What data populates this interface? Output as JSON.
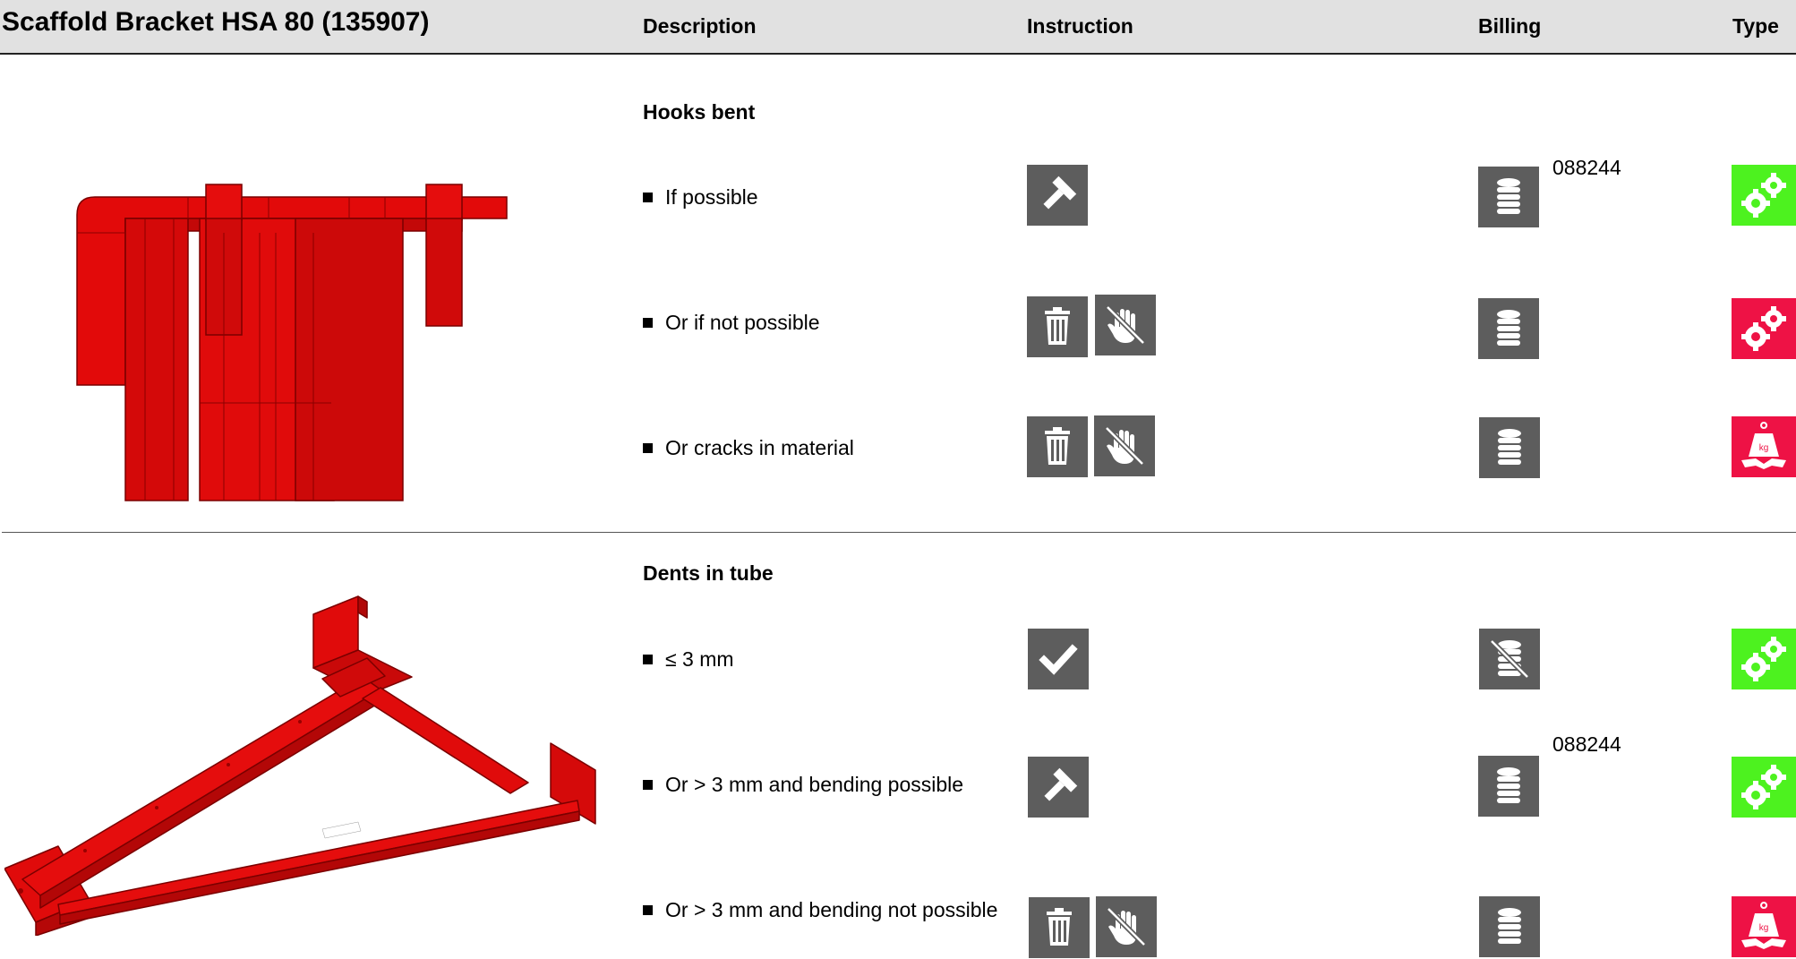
{
  "header": {
    "title": "Scaffold Bracket HSA 80 (135907)",
    "columns": {
      "description": "Description",
      "instruction": "Instruction",
      "billing": "Billing",
      "type": "Type"
    }
  },
  "sections": [
    {
      "title": "Hooks bent",
      "rows": [
        {
          "text": "If possible",
          "instruction_icons": [
            "hammer-icon"
          ],
          "billing_icon": "coin-stack-icon",
          "billing_code": "088244",
          "type_icon": "gears-icon",
          "type_color": "#4df21f"
        },
        {
          "text": "Or if not possible",
          "instruction_icons": [
            "trash-icon",
            "no-hand-icon"
          ],
          "billing_icon": "coin-stack-icon",
          "billing_code": "",
          "type_icon": "gears-icon",
          "type_color": "#ee1245"
        },
        {
          "text": "Or cracks in material",
          "instruction_icons": [
            "trash-icon",
            "no-hand-icon"
          ],
          "billing_icon": "coin-stack-icon",
          "billing_code": "",
          "type_icon": "scrap-weight-icon",
          "type_color": "#ee1245"
        }
      ]
    },
    {
      "title": "Dents in tube",
      "rows": [
        {
          "text": "≤ 3 mm",
          "instruction_icons": [
            "checkmark-icon"
          ],
          "billing_icon": "no-coin-stack-icon",
          "billing_code": "",
          "type_icon": "gears-icon",
          "type_color": "#4df21f"
        },
        {
          "text": "Or > 3 mm and bending possible",
          "instruction_icons": [
            "hammer-icon"
          ],
          "billing_icon": "coin-stack-icon",
          "billing_code": "088244",
          "type_icon": "gears-icon",
          "type_color": "#4df21f"
        },
        {
          "text": "Or > 3 mm and bending not possible",
          "instruction_icons": [
            "trash-icon",
            "no-hand-icon"
          ],
          "billing_icon": "coin-stack-icon",
          "billing_code": "",
          "type_icon": "scrap-weight-icon",
          "type_color": "#ee1245"
        }
      ]
    }
  ],
  "colors": {
    "icon_bg": "#5d5d5d",
    "ok": "#4df21f",
    "scrap": "#ee1245",
    "product": "#e30b0b"
  },
  "kg_label": "kg"
}
